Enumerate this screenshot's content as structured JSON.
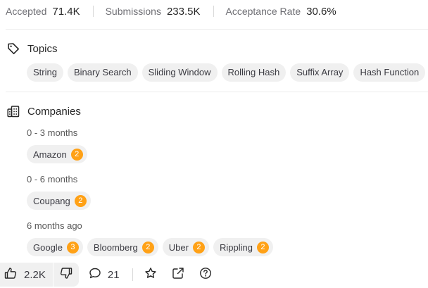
{
  "stats": [
    {
      "label": "Accepted",
      "value": "71.4K"
    },
    {
      "label": "Submissions",
      "value": "233.5K"
    },
    {
      "label": "Acceptance Rate",
      "value": "30.6%"
    }
  ],
  "topics": {
    "title": "Topics",
    "tags": [
      "String",
      "Binary Search",
      "Sliding Window",
      "Rolling Hash",
      "Suffix Array",
      "Hash Function"
    ]
  },
  "companies": {
    "title": "Companies",
    "groups": [
      {
        "period": "0 - 3 months",
        "companies": [
          {
            "name": "Amazon",
            "count": "2"
          }
        ]
      },
      {
        "period": "0 - 6 months",
        "companies": [
          {
            "name": "Coupang",
            "count": "2"
          }
        ]
      },
      {
        "period": "6 months ago",
        "companies": [
          {
            "name": "Google",
            "count": "3"
          },
          {
            "name": "Bloomberg",
            "count": "2"
          },
          {
            "name": "Uber",
            "count": "2"
          },
          {
            "name": "Rippling",
            "count": "2"
          }
        ]
      }
    ]
  },
  "actions": {
    "likes": "2.2K",
    "comments": "21"
  },
  "icons": {
    "topics": "tag-icon",
    "companies": "building-icon",
    "like": "thumbs-up-icon",
    "dislike": "thumbs-down-icon",
    "comments": "speech-bubble-icon",
    "favorite": "star-icon",
    "share": "external-link-icon",
    "help": "question-circle-icon"
  },
  "colors": {
    "accent": "#ffa116",
    "chip_bg": "#f0f0f0",
    "text": "#262626"
  }
}
